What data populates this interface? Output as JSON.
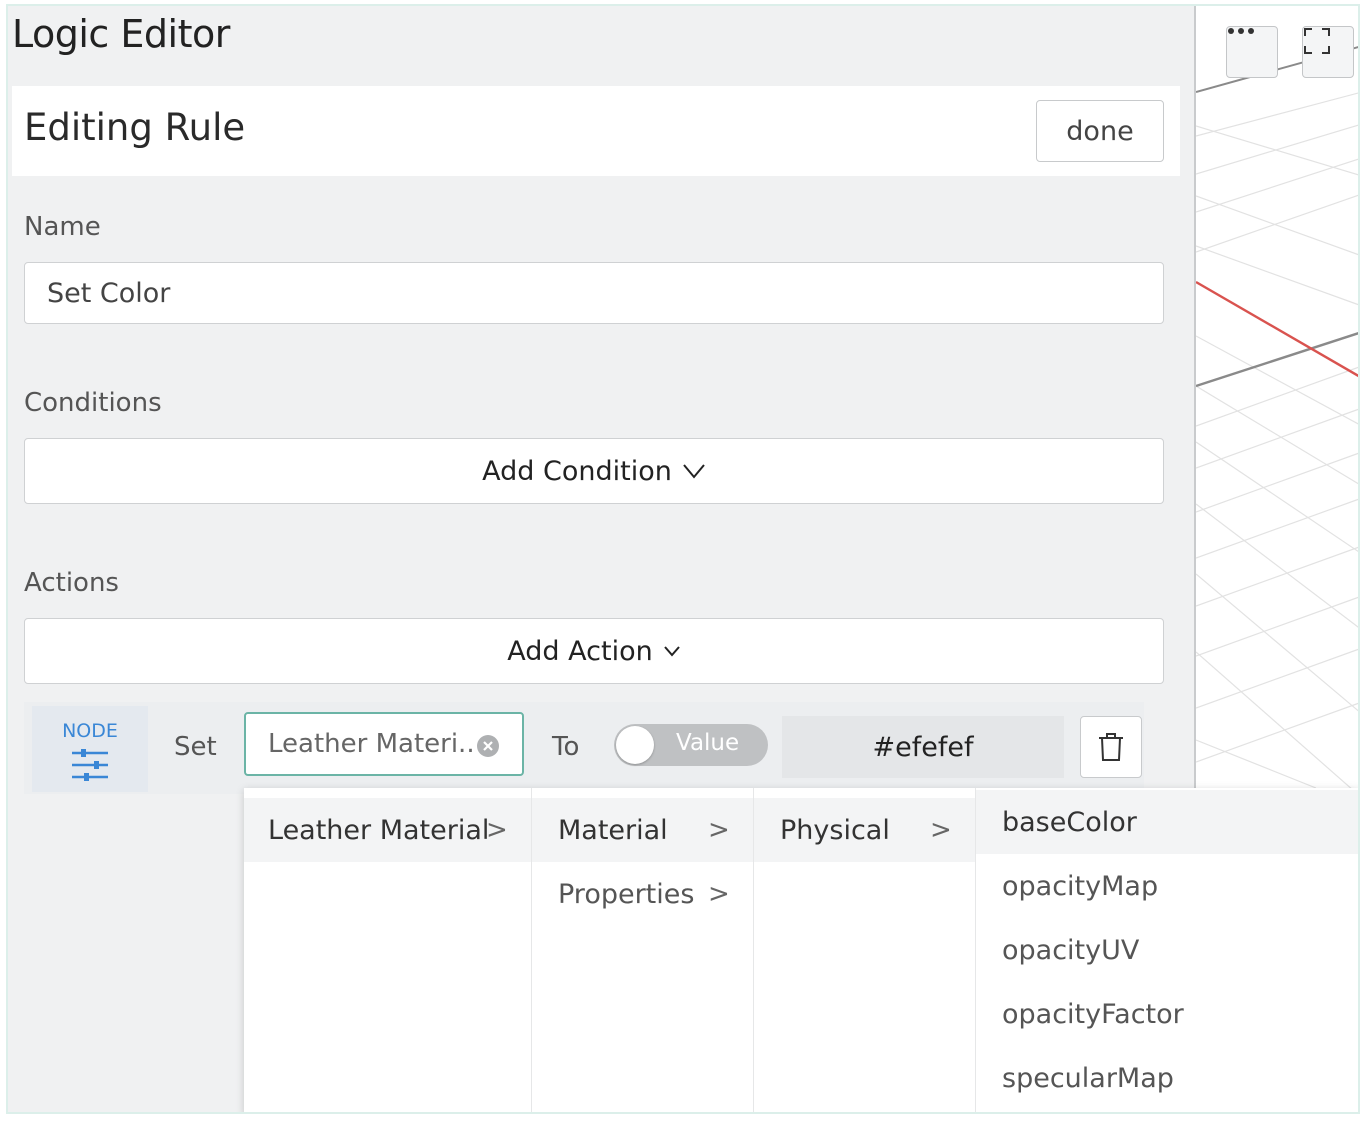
{
  "app": {
    "title": "Logic Editor"
  },
  "viewport": {
    "more_icon": "ellipsis-icon",
    "fullscreen_icon": "fullscreen-icon"
  },
  "rule": {
    "header_title": "Editing Rule",
    "done_label": "done",
    "name_label": "Name",
    "name_value": "Set Color",
    "conditions_label": "Conditions",
    "add_condition_label": "Add Condition",
    "actions_label": "Actions",
    "add_action_label": "Add Action"
  },
  "action": {
    "badge_label": "NODE",
    "badge_icon": "sliders-icon",
    "set_label": "Set",
    "target_value": "Leather Materi..",
    "to_label": "To",
    "toggle_label": "Value",
    "value": "#efefef",
    "delete_icon": "trash-icon"
  },
  "cascader": {
    "col1": [
      {
        "label": "Leather Material",
        "arrow": ">"
      }
    ],
    "col2": [
      {
        "label": "Material",
        "arrow": ">"
      },
      {
        "label": "Properties",
        "arrow": ">"
      }
    ],
    "col3": [
      {
        "label": "Physical",
        "arrow": ">"
      }
    ],
    "col4": [
      {
        "label": "baseColor"
      },
      {
        "label": "opacityMap"
      },
      {
        "label": "opacityUV"
      },
      {
        "label": "opacityFactor"
      },
      {
        "label": "specularMap"
      }
    ]
  },
  "colors": {
    "accent": "#3a87d6",
    "focus_border": "#6bb4a6",
    "axis_x": "#d9534f"
  }
}
